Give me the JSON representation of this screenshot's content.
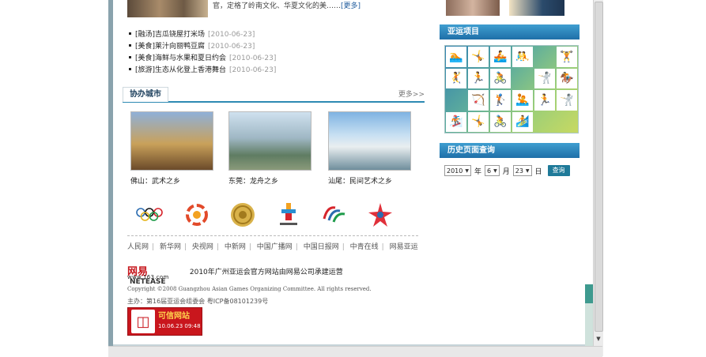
{
  "top_news": {
    "text": "官，定格了岭南文化、华夏文化的美……",
    "more": "[更多]"
  },
  "news_list": [
    {
      "title": "[融汤]吉瓜铙屋打米场",
      "date": "[2010-06-23]"
    },
    {
      "title": "[美食]莱汁向丽鸭豆腐",
      "date": "[2010-06-23]"
    },
    {
      "title": "[美食]海鲜与水果和夏日约会",
      "date": "[2010-06-23]"
    },
    {
      "title": "[旅游]生态从化登上香港舞台",
      "date": "[2010-06-23]"
    }
  ],
  "cohost": {
    "title": "协办城市",
    "more": "更多>>",
    "cities": [
      {
        "caption": "佛山：武术之乡"
      },
      {
        "caption": "东莞：龙舟之乡"
      },
      {
        "caption": "汕尾：民间艺术之乡"
      }
    ]
  },
  "logos": [
    "olympic-rings-logo",
    "asian-games-logo",
    "gold-seal-logo",
    "vancouver-logo",
    "paralympic-logo",
    "star-logo"
  ],
  "links": [
    "人民网",
    "新华网",
    "央视网",
    "中新网",
    "中国广播网",
    "中国日报网",
    "中青在线",
    "网易亚运"
  ],
  "netease": {
    "brand_cn": "网易",
    "brand_en": "NETEASE",
    "url": "www.163.com",
    "text": "2010年广州亚运会官方网站由网易公司承建运营"
  },
  "copyright": "Copyright ©2008 Guangzhou Asian Games Organizing Committee. All rights reserved.",
  "host": "主办：第16届亚运会组委会 粤ICP备08101239号",
  "badge": {
    "title": "可信网站",
    "date": "10.06.23 09:48"
  },
  "sidebar": {
    "sports_title": "亚运项目",
    "history_title": "历史页面查询",
    "sports": [
      "🏊",
      "🤸",
      "🚣",
      "🤼",
      "",
      "🏋",
      "🤾",
      "🏃",
      "🚴",
      "",
      "🤺",
      "🏇",
      "",
      "🏹",
      "🏌",
      "🤽",
      "🏃",
      "🤺",
      "🏂",
      "🤸",
      "🚴",
      "🏄",
      "",
      ""
    ],
    "query": {
      "year": "2010",
      "year_label": "年",
      "month": "6",
      "month_label": "月",
      "day": "23",
      "day_label": "日",
      "button": "查询"
    }
  },
  "colors": {
    "accent": "#1f6fa8",
    "link": "#1d5a9c",
    "badge_red": "#c9161d"
  }
}
